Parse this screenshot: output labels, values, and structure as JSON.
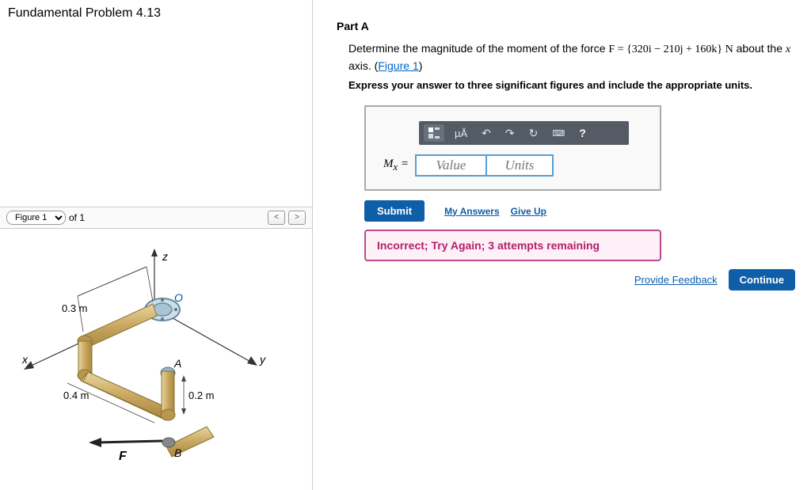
{
  "title": "Fundamental Problem 4.13",
  "figure": {
    "select_value": "Figure 1",
    "of_label": "of 1",
    "labels": {
      "z": "z",
      "x": "x",
      "y": "y",
      "O": "O",
      "A": "A",
      "B": "B",
      "F": "F",
      "d1": "0.3 m",
      "d2": "0.4 m",
      "d3": "0.2 m"
    }
  },
  "partA": {
    "title": "Part A",
    "text_1": "Determine the magnitude of the moment of the force ",
    "force_eq": "F = {320i  −  210j  +  160k} N",
    "text_2": " about the ",
    "axis": "x",
    "text_3": " axis. (",
    "fig_link": "Figure 1",
    "text_4": ")",
    "sigfig": "Express your answer to three significant figures and include the appropriate units.",
    "toolbar": {
      "templates": "templates",
      "micro": "µÅ",
      "undo": "↶",
      "redo": "↷",
      "reset": "↻",
      "keyboard": "⌨",
      "help": "?"
    },
    "input_label": "Mₓ =",
    "value_placeholder": "Value",
    "units_placeholder": "Units",
    "submit": "Submit",
    "my_answers": "My Answers",
    "give_up": "Give Up",
    "feedback": "Incorrect; Try Again; 3 attempts remaining"
  },
  "footer": {
    "provide_feedback": "Provide Feedback",
    "continue": "Continue"
  }
}
